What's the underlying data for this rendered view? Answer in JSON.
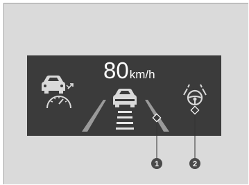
{
  "speed": {
    "value": "80",
    "unit": "km/h"
  },
  "callouts": [
    {
      "number": "1",
      "target": "lane-line"
    },
    {
      "number": "2",
      "target": "steering-assist-indicator"
    }
  ],
  "icons": {
    "left": "car-speedometer-icon",
    "center": "lead-vehicle-icon",
    "right": "steering-wheel-lanes-icon"
  },
  "colors": {
    "background": "#dadada",
    "display": "#3b3b3b",
    "icon": "#d9d9d9",
    "callout_badge": "#4a4a4a"
  }
}
